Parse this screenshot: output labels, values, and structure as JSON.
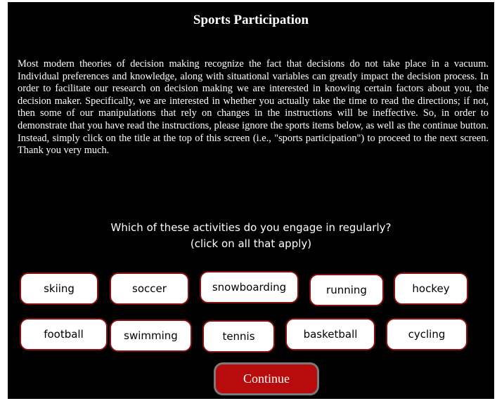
{
  "page": {
    "title": "Sports Participation",
    "instructions": "Most modern theories of decision making recognize the fact that decisions do not take place in a vacuum.  Individual preferences and knowledge, along with situational variables can greatly impact the decision process.  In order to facilitate our research on decision making we are interested in knowing certain factors about you, the decision maker.  Specifically, we are interested in whether you actually take the time to read the directions; if not, then some of our manipulations that rely on changes in the instructions will be ineffective.  So, in order to demonstrate that you have read the instructions, please ignore the sports items below, as well as the continue button. Instead, simply click on the title at the top of this screen (i.e., \"sports participation\") to proceed to the next screen.  Thank you very much.",
    "question_line1": "Which of these activities do you engage in regularly?",
    "question_line2": "(click on all that apply)"
  },
  "activities": [
    "skiing",
    "soccer",
    "snowboarding",
    "running",
    "hockey",
    "football",
    "swimming",
    "tennis",
    "basketball",
    "cycling"
  ],
  "continue_label": "Continue",
  "colors": {
    "background": "#000000",
    "text": "#ffffff",
    "pill_border": "#8a1010",
    "continue_fill": "#b80c0c"
  }
}
